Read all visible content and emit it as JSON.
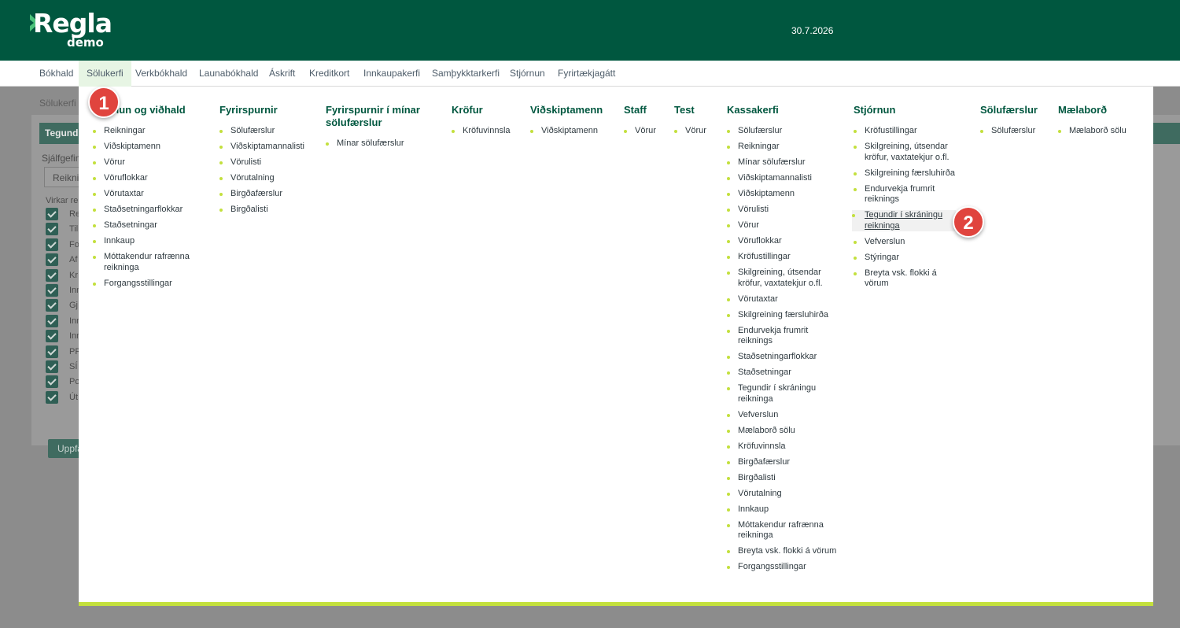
{
  "header": {
    "logo_word": "Regla",
    "logo_sub": "demo",
    "date": "30.7.2026"
  },
  "nav": {
    "items": [
      "Bókhald",
      "Sölukerfi",
      "Verkbókhald",
      "Launabókhald",
      "Áskrift",
      "Kreditkort",
      "Innkaupakerfi",
      "Samþykktarkerfi",
      "Stjórnun",
      "Fyrirtækjagátt"
    ],
    "active": "Sölukerfi"
  },
  "background": {
    "breadcrumb": "Sölukerfi",
    "panel_title": "Tegundi",
    "label_custom": "Sjálfgefin",
    "select_value": "Reiknin",
    "label_active": "Virkar re",
    "rows": [
      "Re",
      "Til",
      "Fo",
      "Af",
      "Kr",
      "Inn",
      "Gj",
      "Inn",
      "Inn",
      "PR",
      "SÍ",
      "Po",
      "Út"
    ],
    "button_label": "Uppfæ"
  },
  "menu": {
    "columns": [
      {
        "title": "Stofnun og viðhald",
        "items": [
          "Reikningar",
          "Viðskiptamenn",
          "Vörur",
          "Vöruflokkar",
          "Vörutaxtar",
          "Staðsetningarflokkar",
          "Staðsetningar",
          "Innkaup",
          "Móttakendur rafrænna reikninga",
          "Forgangsstillingar"
        ]
      },
      {
        "title": "Fyrirspurnir",
        "items": [
          "Sölufærslur",
          "Viðskiptamannalisti",
          "Vörulisti",
          "Vörutalning",
          "Birgðafærslur",
          "Birgðalisti"
        ]
      },
      {
        "title": "Fyrirspurnir í mínar sölufærslur",
        "items": [
          "Mínar sölufærslur"
        ]
      },
      {
        "title": "Kröfur",
        "items": [
          "Kröfuvinnsla"
        ]
      },
      {
        "title": "Viðskiptamenn",
        "items": [
          "Viðskiptamenn"
        ]
      },
      {
        "title": "Staff",
        "items": [
          "Vörur"
        ]
      },
      {
        "title": "Test",
        "items": [
          "Vörur"
        ]
      },
      {
        "title": "Kassakerfi",
        "items": [
          "Sölufærslur",
          "Reikningar",
          "Mínar sölufærslur",
          "Viðskiptamannalisti",
          "Viðskiptamenn",
          "Vörulisti",
          "Vörur",
          "Vöruflokkar",
          "Kröfustillingar",
          "Skilgreining, útsendar kröfur, vaxtatekjur o.fl.",
          "Vörutaxtar",
          "Skilgreining færsluhirða",
          "Endurvekja frumrit reiknings",
          "Staðsetningarflokkar",
          "Staðsetningar",
          "Tegundir í skráningu reikninga",
          "Vefverslun",
          "Mælaborð sölu",
          "Kröfuvinnsla",
          "Birgðafærslur",
          "Birgðalisti",
          "Vörutalning",
          "Innkaup",
          "Móttakendur rafrænna reikninga",
          "Breyta vsk. flokki á vörum",
          "Forgangsstillingar"
        ]
      },
      {
        "title": "Stjórnun",
        "items": [
          "Kröfustillingar",
          "Skilgreining, útsendar kröfur, vaxtatekjur o.fl.",
          "Skilgreining færsluhirða",
          "Endurvekja frumrit reiknings",
          "Tegundir í skráningu reikninga",
          "Vefverslun",
          "Stýringar",
          "Breyta vsk. flokki á vörum"
        ],
        "highlight_index": 4
      },
      {
        "title": "Sölufærslur",
        "items": [
          "Sölufærslur"
        ]
      },
      {
        "title": "Mælaborð",
        "items": [
          "Mælaborð sölu"
        ]
      }
    ]
  },
  "markers": [
    "1",
    "2"
  ],
  "colors": {
    "brand": "#00573f",
    "accent": "#c3e03d",
    "marker": "#e0443e"
  }
}
